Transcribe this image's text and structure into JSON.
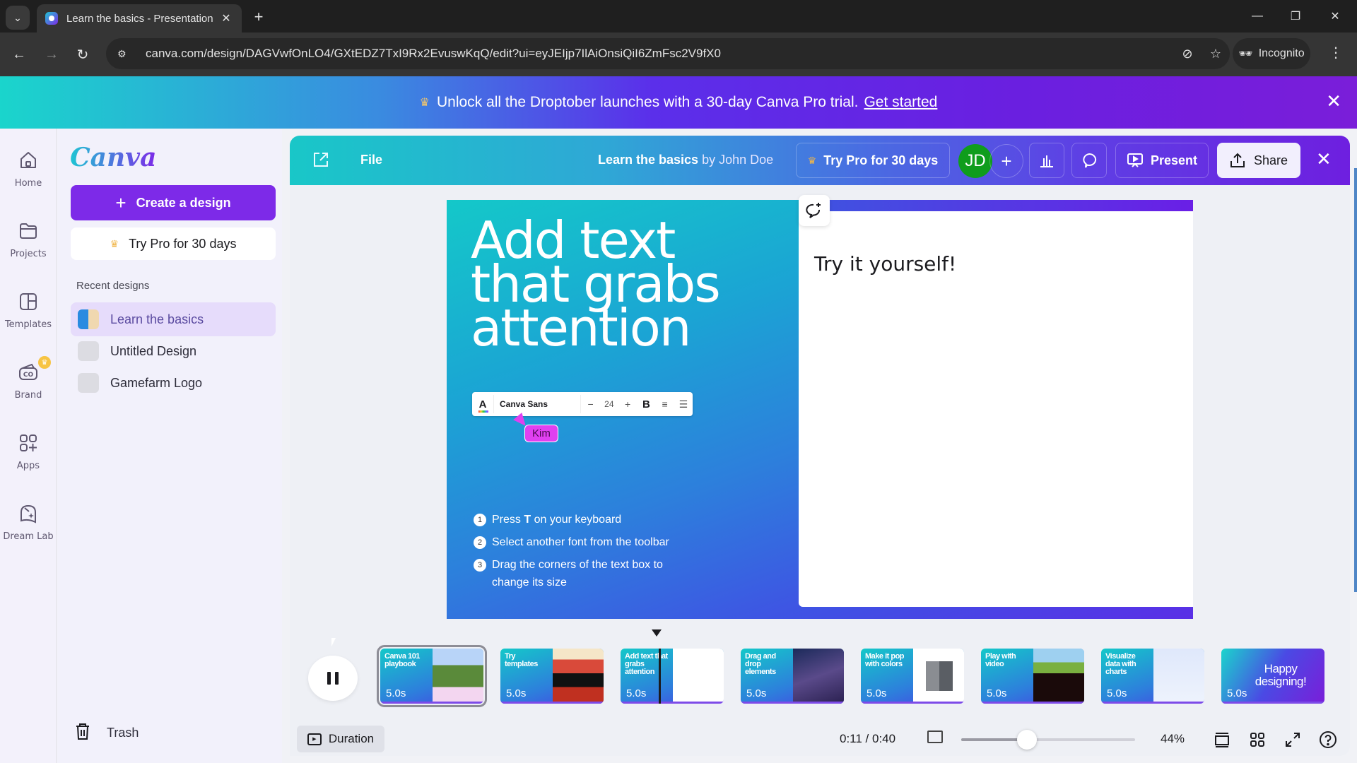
{
  "browser": {
    "tab_title": "Learn the basics - Presentation",
    "url": "canva.com/design/DAGVwfOnLO4/GXtEDZ7TxI9Rx2EvuswKqQ/edit?ui=eyJEIjp7IlAiOnsiQiI6ZmFsc2V9fX0",
    "incognito_label": "Incognito"
  },
  "promo": {
    "text": "Unlock all the Droptober launches with a 30-day Canva Pro trial.",
    "link": "Get started"
  },
  "rail": {
    "items": [
      {
        "label": "Home"
      },
      {
        "label": "Projects"
      },
      {
        "label": "Templates"
      },
      {
        "label": "Brand"
      },
      {
        "label": "Apps"
      },
      {
        "label": "Dream Lab"
      }
    ]
  },
  "panel": {
    "logo": "Canva",
    "create_label": "Create a design",
    "try_pro_label": "Try Pro for 30 days",
    "recent_heading": "Recent designs",
    "recent": [
      {
        "name": "Learn the basics"
      },
      {
        "name": "Untitled Design"
      },
      {
        "name": "Gamefarm Logo"
      }
    ],
    "trash_label": "Trash"
  },
  "editor": {
    "file_label": "File",
    "design_title": "Learn the basics",
    "by_author": "by John Doe",
    "try_pro_label": "Try Pro for 30 days",
    "avatar_initials": "JD",
    "present_label": "Present",
    "share_label": "Share"
  },
  "slide": {
    "headline": [
      "Add text",
      "that grabs",
      "attention"
    ],
    "toolbar": {
      "font": "Canva Sans",
      "size": "24"
    },
    "collaborator": "Kim",
    "steps": [
      {
        "num": "1",
        "text_html_pre": "Press ",
        "bold": "T",
        "text_post": " on your keyboard"
      },
      {
        "num": "2",
        "text": "Select another font from the toolbar"
      },
      {
        "num": "3",
        "text": "Drag the corners of the text box to change its size"
      }
    ],
    "card_text": "Try it yourself!"
  },
  "timeline": {
    "pages": [
      {
        "title": "Canva 101 playbook",
        "duration": "5.0s"
      },
      {
        "title": "Try templates",
        "duration": "5.0s"
      },
      {
        "title": "Add text that grabs attention",
        "duration": "5.0s"
      },
      {
        "title": "Drag and drop elements",
        "duration": "5.0s"
      },
      {
        "title": "Make it pop with colors",
        "duration": "5.0s"
      },
      {
        "title": "Play with video",
        "duration": "5.0s"
      },
      {
        "title": "Visualize data with charts",
        "duration": "5.0s"
      },
      {
        "title": "Happy designing!",
        "duration": "5.0s"
      }
    ],
    "selected_index": 0
  },
  "footer": {
    "duration_label": "Duration",
    "time": "0:11 / 0:40",
    "zoom_percent": "44%",
    "zoom_value": 0.38
  },
  "colors": {
    "brand_purple": "#7d2ae8",
    "brand_teal": "#1fc5d3",
    "avatar_green": "#0f9d1c",
    "collaborator_pink": "#e040f0"
  }
}
